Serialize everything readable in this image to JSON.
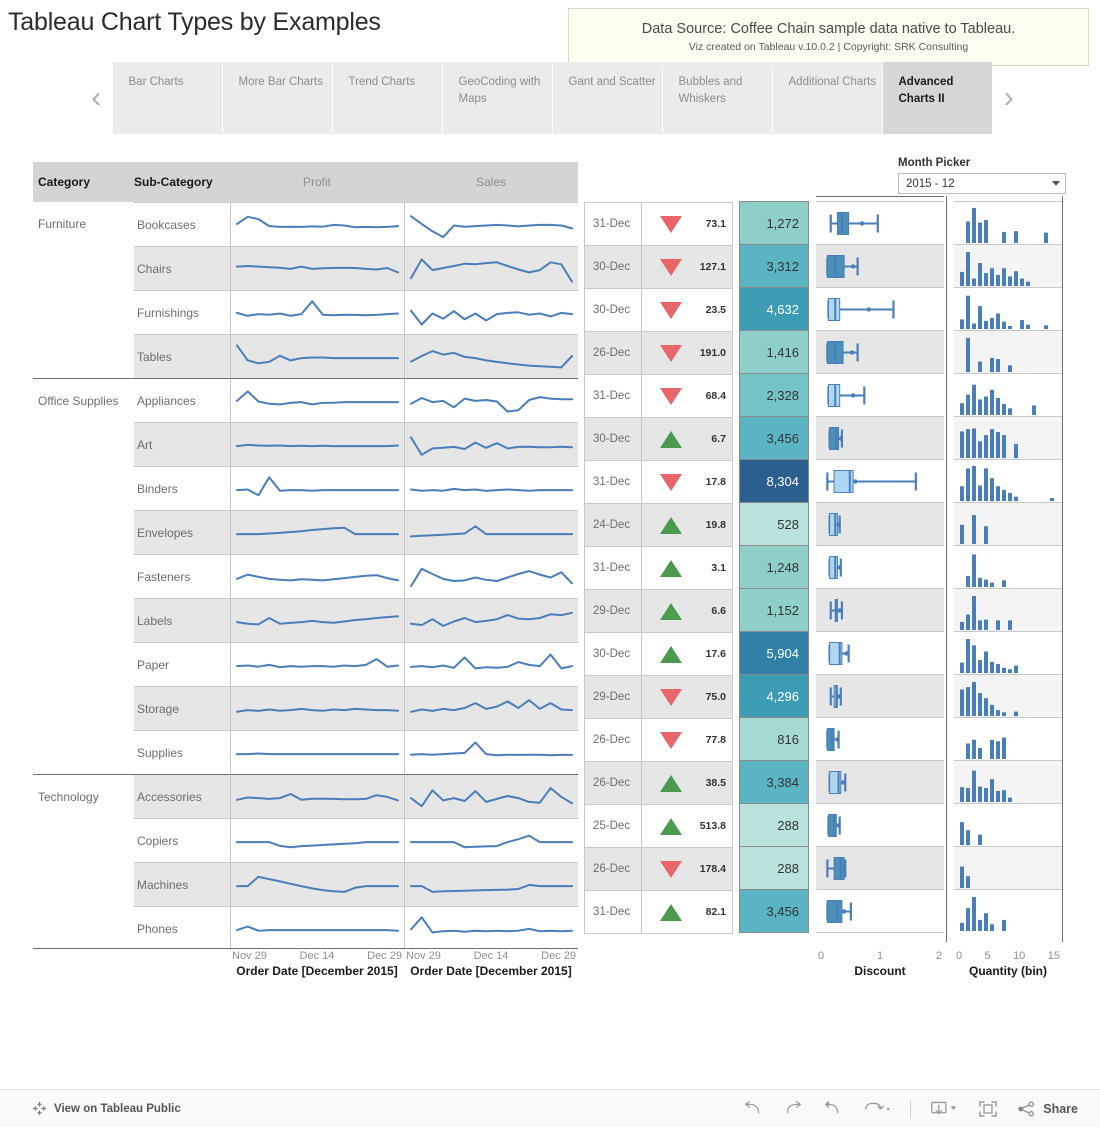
{
  "page_title": "Tableau Chart Types by Examples",
  "datasource": {
    "title": "Data Source: Coffee Chain sample data native to Tableau.",
    "subtitle": "Viz created on Tableau v.10.0.2 | Copyright: SRK Consulting"
  },
  "tabs": {
    "prev_arrow": "‹",
    "next_arrow": "›",
    "items": [
      {
        "label": "Bar Charts",
        "active": false
      },
      {
        "label": "More Bar Charts",
        "active": false
      },
      {
        "label": "Trend Charts",
        "active": false
      },
      {
        "label": "GeoCoding with Maps",
        "active": false
      },
      {
        "label": "Gant and Scatter",
        "active": false
      },
      {
        "label": "Bubbles and Whiskers",
        "active": false
      },
      {
        "label": "Additional Charts",
        "active": false
      },
      {
        "label": "Advanced Charts II",
        "active": true
      }
    ]
  },
  "month_picker": {
    "label": "Month Picker",
    "value": "2015 - 12"
  },
  "table": {
    "headers": {
      "category": "Category",
      "sub_category": "Sub-Category",
      "profit": "Profit",
      "sales": "Sales"
    },
    "axis": {
      "ticks": [
        "Nov 29",
        "Dec 14",
        "Dec 29"
      ],
      "profit_title": "Order Date [December 2015]",
      "sales_title": "Order Date [December 2015]"
    },
    "box_axis": {
      "ticks": [
        "0",
        "1",
        "2"
      ],
      "title": "Discount"
    },
    "hist_axis": {
      "ticks": [
        "0",
        "5",
        "10",
        "15"
      ],
      "title": "Quantity (bin)"
    }
  },
  "colors": {
    "sparkline": "#4a7ebb",
    "up_arrow": "#4a9b4e",
    "down_arrow": "#e8656a",
    "header_band": "#d4d4d4",
    "alt_row": "#e6e6e6",
    "box_fill": "#aed6f1",
    "box_fill_dark": "#4a90b8",
    "hist_bar": "#4a7ebb",
    "heat_low": "#b9e3dc",
    "heat_high": "#2a5f8f"
  },
  "rows": [
    {
      "category": "Furniture",
      "sub_category": "Bookcases",
      "date": "31-Dec",
      "direction": "down",
      "change": "73.1",
      "sales": "1,272",
      "sales_color": "#8ecfc9",
      "sales_text": "#333333",
      "profit_spark": [
        55,
        80,
        72,
        48,
        45,
        46,
        45,
        47,
        46,
        52,
        50,
        44,
        45,
        44,
        45,
        48
      ],
      "sales_spark": [
        82,
        55,
        30,
        10,
        50,
        46,
        48,
        50,
        52,
        50,
        47,
        50,
        52,
        52,
        50,
        40
      ],
      "box": {
        "wlo": 6,
        "q1": 12,
        "med": 16,
        "q3": 22,
        "whi": 48,
        "dot": 34,
        "dark": true
      },
      "hist": [
        0,
        58,
        95,
        55,
        62,
        0,
        0,
        30,
        0,
        32,
        0,
        0,
        0,
        0,
        28,
        0
      ]
    },
    {
      "category": "",
      "sub_category": "Chairs",
      "date": "30-Dec",
      "direction": "down",
      "change": "127.1",
      "sales": "3,312",
      "sales_color": "#5ab4c4",
      "sales_text": "#333333",
      "profit_spark": [
        60,
        62,
        60,
        58,
        56,
        52,
        60,
        52,
        54,
        55,
        56,
        55,
        52,
        50,
        55,
        40
      ],
      "sales_spark": [
        20,
        85,
        48,
        55,
        62,
        70,
        68,
        72,
        75,
        62,
        50,
        40,
        48,
        75,
        68,
        8
      ],
      "box": {
        "wlo": 3,
        "q1": 3,
        "med": 10,
        "q3": 18,
        "whi": 30,
        "dot": 26,
        "dark": true
      },
      "hist": [
        38,
        92,
        20,
        62,
        35,
        48,
        30,
        48,
        26,
        40,
        20,
        12,
        0,
        0,
        0,
        0
      ]
    },
    {
      "category": "",
      "sub_category": "Furnishings",
      "date": "30-Dec",
      "direction": "down",
      "change": "23.5",
      "sales": "4,632",
      "sales_color": "#3c9cb4",
      "sales_text": "#ffffff",
      "profit_spark": [
        52,
        42,
        48,
        46,
        50,
        42,
        48,
        92,
        46,
        44,
        46,
        45,
        44,
        45,
        48,
        50
      ],
      "sales_spark": [
        60,
        12,
        50,
        32,
        58,
        30,
        50,
        26,
        48,
        52,
        54,
        46,
        50,
        40,
        52,
        48
      ],
      "box": {
        "wlo": 4,
        "q1": 4,
        "med": 10,
        "q3": 14,
        "whi": 62,
        "dot": 40,
        "dark": false
      },
      "hist": [
        26,
        90,
        15,
        62,
        22,
        30,
        42,
        20,
        8,
        0,
        24,
        12,
        0,
        0,
        10,
        0
      ]
    },
    {
      "category": "",
      "sub_category": "Tables",
      "date": "26-Dec",
      "direction": "down",
      "change": "191.0",
      "sales": "1,416",
      "sales_color": "#8ecfc9",
      "sales_text": "#333333",
      "profit_spark": [
        92,
        40,
        30,
        35,
        56,
        40,
        48,
        50,
        50,
        48,
        48,
        48,
        48,
        48,
        48,
        48
      ],
      "sales_spark": [
        36,
        55,
        72,
        60,
        66,
        52,
        48,
        40,
        35,
        30,
        26,
        22,
        20,
        18,
        16,
        55
      ],
      "box": {
        "wlo": 3,
        "q1": 3,
        "med": 10,
        "q3": 17,
        "whi": 30,
        "dot": 25,
        "dark": true
      },
      "hist": [
        0,
        92,
        0,
        28,
        0,
        38,
        35,
        0,
        18,
        0,
        0,
        0,
        0,
        0,
        0,
        0
      ]
    },
    {
      "category": "Office Supplies",
      "sub_category": "Appliances",
      "date": "31-Dec",
      "direction": "down",
      "change": "68.4",
      "sales": "2,328",
      "sales_color": "#74c3c6",
      "sales_text": "#333333",
      "profit_spark": [
        52,
        85,
        50,
        42,
        40,
        45,
        48,
        40,
        45,
        46,
        48,
        48,
        48,
        48,
        48,
        48
      ],
      "sales_spark": [
        42,
        62,
        48,
        52,
        30,
        60,
        52,
        55,
        50,
        15,
        20,
        55,
        65,
        60,
        58,
        58
      ],
      "box": {
        "wlo": 4,
        "q1": 4,
        "med": 10,
        "q3": 14,
        "whi": 36,
        "dot": 26,
        "dark": false
      },
      "hist": [
        32,
        55,
        82,
        42,
        50,
        68,
        46,
        30,
        18,
        0,
        0,
        0,
        26,
        0,
        0,
        0
      ]
    },
    {
      "category": "",
      "sub_category": "Art",
      "date": "30-Dec",
      "direction": "up",
      "change": "6.7",
      "sales": "3,456",
      "sales_color": "#5ab4c4",
      "sales_text": "#333333",
      "profit_spark": [
        48,
        52,
        50,
        49,
        50,
        48,
        49,
        48,
        49,
        48,
        48,
        48,
        48,
        48,
        48,
        50
      ],
      "sales_spark": [
        78,
        18,
        40,
        42,
        45,
        38,
        60,
        42,
        58,
        40,
        45,
        46,
        44,
        44,
        46,
        44
      ],
      "box": {
        "wlo": 5,
        "q1": 5,
        "med": 11,
        "q3": 13,
        "whi": 16,
        "dot": 15,
        "dark": true
      },
      "hist": [
        72,
        78,
        80,
        45,
        62,
        78,
        70,
        62,
        0,
        38,
        0,
        0,
        0,
        0,
        0,
        0
      ]
    },
    {
      "category": "",
      "sub_category": "Binders",
      "date": "31-Dec",
      "direction": "down",
      "change": "17.8",
      "sales": "8,304",
      "sales_color": "#2a5f8f",
      "sales_text": "#ffffff",
      "profit_spark": [
        48,
        50,
        30,
        92,
        46,
        48,
        48,
        46,
        48,
        48,
        48,
        48,
        48,
        48,
        48,
        48
      ],
      "sales_spark": [
        50,
        46,
        48,
        46,
        52,
        48,
        50,
        45,
        48,
        50,
        48,
        46,
        48,
        48,
        48,
        48
      ],
      "box": {
        "wlo": 3,
        "q1": 9,
        "med": 23,
        "q3": 26,
        "whi": 82,
        "dot": 28,
        "dark": false
      },
      "hist": [
        40,
        88,
        95,
        42,
        88,
        62,
        40,
        30,
        22,
        12,
        0,
        0,
        0,
        0,
        0,
        8
      ]
    },
    {
      "category": "",
      "sub_category": "Envelopes",
      "date": "24-Dec",
      "direction": "up",
      "change": "19.8",
      "sales": "528",
      "sales_color": "#b9e3dc",
      "sales_text": "#333333",
      "profit_spark": [
        48,
        48,
        48,
        50,
        52,
        55,
        58,
        62,
        65,
        68,
        70,
        48,
        48,
        48,
        48,
        48
      ],
      "sales_spark": [
        40,
        42,
        44,
        46,
        48,
        50,
        75,
        48,
        48,
        48,
        48,
        48,
        48,
        48,
        48,
        48
      ],
      "box": {
        "wlo": 5,
        "q1": 5,
        "med": 10,
        "q3": 12,
        "whi": 14,
        "dot": 13,
        "dark": false
      },
      "hist": [
        52,
        0,
        78,
        0,
        48,
        0,
        0,
        0,
        0,
        0,
        0,
        0,
        0,
        0,
        0,
        0
      ]
    },
    {
      "category": "",
      "sub_category": "Fasteners",
      "date": "31-Dec",
      "direction": "up",
      "change": "3.1",
      "sales": "1,248",
      "sales_color": "#8ecfc9",
      "sales_text": "#333333",
      "profit_spark": [
        45,
        60,
        52,
        45,
        42,
        40,
        44,
        42,
        40,
        44,
        48,
        52,
        56,
        58,
        48,
        40
      ],
      "sales_spark": [
        20,
        80,
        62,
        45,
        38,
        40,
        50,
        42,
        38,
        50,
        62,
        72,
        60,
        50,
        68,
        30
      ],
      "box": {
        "wlo": 5,
        "q1": 5,
        "med": 10,
        "q3": 12,
        "whi": 15,
        "dot": 14,
        "dark": false
      },
      "hist": [
        0,
        30,
        88,
        25,
        20,
        12,
        0,
        18,
        0,
        0,
        0,
        0,
        0,
        0,
        0,
        0
      ]
    },
    {
      "category": "",
      "sub_category": "Labels",
      "date": "29-Dec",
      "direction": "up",
      "change": "6.6",
      "sales": "1,152",
      "sales_color": "#8ecfc9",
      "sales_text": "#333333",
      "profit_spark": [
        48,
        42,
        40,
        62,
        42,
        45,
        48,
        52,
        48,
        46,
        50,
        55,
        58,
        62,
        65,
        68
      ],
      "sales_spark": [
        42,
        38,
        58,
        35,
        50,
        62,
        48,
        52,
        58,
        72,
        60,
        58,
        62,
        75,
        72,
        80
      ],
      "box": {
        "wlo": 6,
        "q1": 10,
        "med": 11,
        "q3": 12,
        "whi": 16,
        "dot": 14,
        "dark": false
      },
      "hist": [
        22,
        42,
        92,
        26,
        28,
        0,
        26,
        0,
        26,
        0,
        0,
        0,
        0,
        0,
        0,
        0
      ]
    },
    {
      "category": "",
      "sub_category": "Paper",
      "date": "30-Dec",
      "direction": "up",
      "change": "17.6",
      "sales": "5,904",
      "sales_color": "#3080a8",
      "sales_text": "#ffffff",
      "profit_spark": [
        48,
        50,
        46,
        52,
        44,
        48,
        46,
        48,
        48,
        46,
        50,
        48,
        52,
        72,
        46,
        50
      ],
      "sales_spark": [
        45,
        48,
        44,
        50,
        42,
        78,
        40,
        44,
        42,
        45,
        62,
        52,
        48,
        88,
        40,
        48
      ],
      "box": {
        "wlo": 5,
        "q1": 5,
        "med": 14,
        "q3": 16,
        "whi": 22,
        "dot": 20,
        "dark": false
      },
      "hist": [
        28,
        92,
        75,
        35,
        58,
        30,
        24,
        14,
        10,
        20,
        0,
        0,
        0,
        0,
        0,
        0
      ]
    },
    {
      "category": "",
      "sub_category": "Storage",
      "date": "29-Dec",
      "direction": "down",
      "change": "75.0",
      "sales": "4,296",
      "sales_color": "#3c9cb4",
      "sales_text": "#ffffff",
      "profit_spark": [
        42,
        48,
        45,
        50,
        46,
        48,
        52,
        48,
        46,
        50,
        48,
        52,
        50,
        48,
        48,
        46
      ],
      "sales_spark": [
        42,
        50,
        45,
        52,
        48,
        55,
        72,
        52,
        60,
        78,
        55,
        82,
        52,
        72,
        50,
        48
      ],
      "box": {
        "wlo": 6,
        "q1": 9,
        "med": 11,
        "q3": 12,
        "whi": 15,
        "dot": 13,
        "dark": false
      },
      "hist": [
        72,
        78,
        92,
        62,
        48,
        30,
        16,
        10,
        0,
        12,
        0,
        0,
        0,
        0,
        0,
        0
      ]
    },
    {
      "category": "",
      "sub_category": "Supplies",
      "date": "26-Dec",
      "direction": "down",
      "change": "77.8",
      "sales": "816",
      "sales_color": "#a5dad4",
      "sales_text": "#333333",
      "profit_spark": [
        48,
        48,
        50,
        48,
        48,
        48,
        48,
        48,
        48,
        48,
        48,
        48,
        48,
        48,
        48,
        48
      ],
      "sales_spark": [
        46,
        48,
        46,
        48,
        50,
        52,
        88,
        48,
        44,
        46,
        45,
        46,
        46,
        44,
        45,
        45
      ],
      "box": {
        "wlo": 3,
        "q1": 3,
        "med": 7,
        "q3": 9,
        "whi": 13,
        "dot": 12,
        "dark": true
      },
      "hist": [
        0,
        42,
        52,
        30,
        0,
        52,
        48,
        58,
        0,
        0,
        0,
        0,
        0,
        0,
        0,
        0
      ]
    },
    {
      "category": "Technology",
      "sub_category": "Accessories",
      "date": "26-Dec",
      "direction": "up",
      "change": "38.5",
      "sales": "3,384",
      "sales_color": "#5ab4c4",
      "sales_text": "#333333",
      "profit_spark": [
        42,
        50,
        48,
        45,
        48,
        62,
        42,
        46,
        46,
        45,
        44,
        44,
        45,
        58,
        52,
        40
      ],
      "sales_spark": [
        48,
        20,
        75,
        40,
        48,
        38,
        72,
        35,
        45,
        55,
        48,
        35,
        32,
        82,
        52,
        30
      ],
      "box": {
        "wlo": 5,
        "q1": 5,
        "med": 13,
        "q3": 15,
        "whi": 19,
        "dot": 17,
        "dark": false
      },
      "hist": [
        40,
        38,
        85,
        42,
        38,
        62,
        30,
        32,
        12,
        0,
        0,
        0,
        0,
        0,
        0,
        0
      ]
    },
    {
      "category": "",
      "sub_category": "Copiers",
      "date": "25-Dec",
      "direction": "up",
      "change": "513.8",
      "sales": "288",
      "sales_color": "#b9e3dc",
      "sales_text": "#333333",
      "profit_spark": [
        48,
        48,
        48,
        48,
        35,
        30,
        34,
        36,
        38,
        40,
        42,
        44,
        48,
        48,
        48,
        48
      ],
      "sales_spark": [
        48,
        48,
        48,
        48,
        48,
        30,
        32,
        33,
        34,
        48,
        58,
        70,
        48,
        48,
        48,
        48
      ],
      "box": {
        "wlo": 4,
        "q1": 4,
        "med": 9,
        "q3": 11,
        "whi": 14,
        "dot": 13,
        "dark": true
      },
      "hist": [
        62,
        40,
        0,
        28,
        0,
        0,
        0,
        0,
        0,
        0,
        0,
        0,
        0,
        0,
        0,
        0
      ]
    },
    {
      "category": "",
      "sub_category": "Machines",
      "date": "26-Dec",
      "direction": "down",
      "change": "178.4",
      "sales": "288",
      "sales_color": "#b9e3dc",
      "sales_text": "#333333",
      "profit_spark": [
        48,
        48,
        80,
        72,
        64,
        56,
        48,
        40,
        34,
        30,
        28,
        42,
        48,
        48,
        48,
        48
      ],
      "sales_spark": [
        48,
        48,
        28,
        30,
        31,
        32,
        33,
        34,
        35,
        36,
        38,
        52,
        48,
        48,
        48,
        48
      ],
      "box": {
        "wlo": 3,
        "q1": 9,
        "med": 15,
        "q3": 18,
        "whi": 19,
        "dot": 18,
        "dark": true
      },
      "hist": [
        58,
        32,
        0,
        0,
        0,
        0,
        0,
        0,
        0,
        0,
        0,
        0,
        0,
        0,
        0,
        0
      ]
    },
    {
      "category": "",
      "sub_category": "Phones",
      "date": "31-Dec",
      "direction": "up",
      "change": "82.1",
      "sales": "3,456",
      "sales_color": "#5ab4c4",
      "sales_text": "#333333",
      "profit_spark": [
        48,
        60,
        46,
        48,
        48,
        48,
        48,
        48,
        48,
        48,
        48,
        48,
        48,
        48,
        48,
        46
      ],
      "sales_spark": [
        50,
        92,
        40,
        44,
        46,
        42,
        46,
        44,
        46,
        44,
        46,
        52,
        44,
        46,
        44,
        46
      ],
      "box": {
        "wlo": 3,
        "q1": 3,
        "med": 12,
        "q3": 16,
        "whi": 24,
        "dot": 18,
        "dark": true
      },
      "hist": [
        22,
        62,
        92,
        30,
        48,
        18,
        0,
        30,
        0,
        0,
        0,
        0,
        0,
        0,
        0,
        0
      ]
    }
  ],
  "toolbar": {
    "view_public": "View on Tableau Public",
    "share": "Share",
    "icons": [
      "undo-icon",
      "redo-icon",
      "revert-icon",
      "refresh-icon",
      "download-icon",
      "fullscreen-icon",
      "share-icon"
    ]
  }
}
